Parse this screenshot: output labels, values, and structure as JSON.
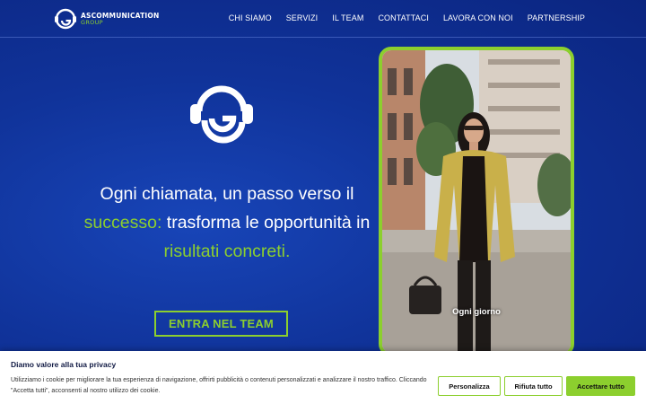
{
  "header": {
    "logo": {
      "name": "ASCOMMUNICATION",
      "group": "GROUP"
    },
    "nav": [
      {
        "label": "CHI SIAMO"
      },
      {
        "label": "SERVIZI"
      },
      {
        "label": "IL TEAM"
      },
      {
        "label": "CONTATTACI"
      },
      {
        "label": "LAVORA CON NOI"
      },
      {
        "label": "PARTNERSHIP"
      }
    ]
  },
  "hero": {
    "icon": "headset-g-icon",
    "headline": {
      "part1": "Ogni chiamata, un passo verso il",
      "accent1": "successo:",
      "part2": " trasforma le opportunità in ",
      "accent2": "risultati concreti."
    },
    "cta_label": "ENTRA NEL TEAM"
  },
  "video": {
    "caption": "Ogni giorno"
  },
  "cookie": {
    "title": "Diamo valore alla tua privacy",
    "text": "Utilizziamo i cookie per migliorare la tua esperienza di navigazione, offrirti pubblicità o contenuti personalizzati e analizzare il nostro traffico. Cliccando \"Accetta tutti\", acconsenti al nostro utilizzo dei cookie.",
    "buttons": {
      "customize": "Personalizza",
      "reject": "Rifiuta tutto",
      "accept": "Accettare tutto"
    }
  },
  "colors": {
    "accent": "#8ccf2e",
    "background": "#10339a"
  }
}
